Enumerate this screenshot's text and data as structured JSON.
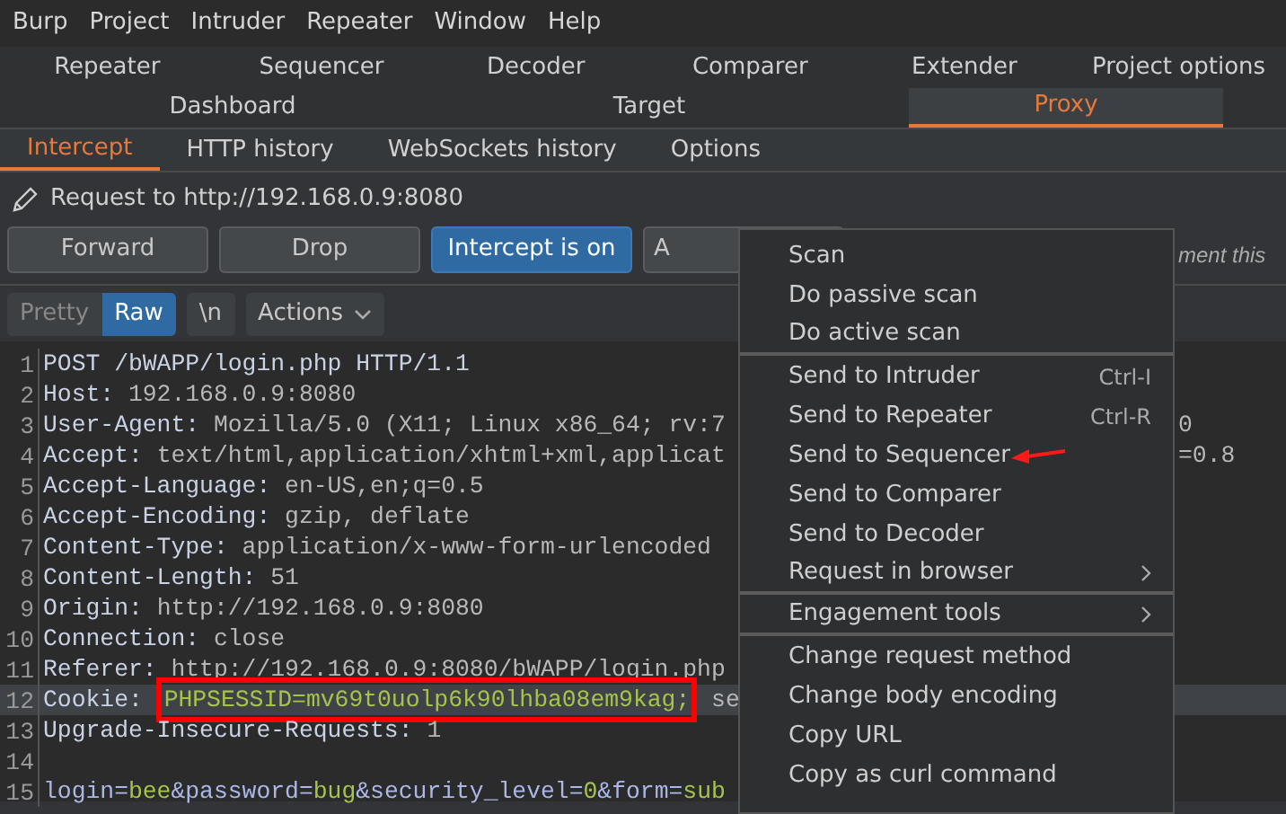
{
  "menu_bar": [
    "Burp",
    "Project",
    "Intruder",
    "Repeater",
    "Window",
    "Help"
  ],
  "tool_tabs_row_1": [
    {
      "label": "Repeater",
      "selected": false
    },
    {
      "label": "Sequencer",
      "selected": false
    },
    {
      "label": "Decoder",
      "selected": false
    },
    {
      "label": "Comparer",
      "selected": false
    },
    {
      "label": "Extender",
      "selected": false
    },
    {
      "label": "Project options",
      "selected": false
    }
  ],
  "tool_tabs_row_2": [
    {
      "label": "Dashboard",
      "selected": false
    },
    {
      "label": "Target",
      "selected": false
    },
    {
      "label": "Proxy",
      "selected": true
    }
  ],
  "proxy_tabs": [
    {
      "label": "Intercept",
      "selected": true
    },
    {
      "label": "HTTP history",
      "selected": false
    },
    {
      "label": "WebSockets history",
      "selected": false
    },
    {
      "label": "Options",
      "selected": false
    }
  ],
  "request_title": "Request to http://192.168.0.9:8080",
  "buttons": [
    {
      "label": "Forward",
      "kind": "plain"
    },
    {
      "label": "Drop",
      "kind": "plain"
    },
    {
      "label": "Intercept is on",
      "kind": "toggle"
    },
    {
      "label": "A",
      "kind": "plain"
    }
  ],
  "comment_field": {
    "value": "ment this"
  },
  "editor_toolbar": {
    "views": [
      {
        "label": "Pretty",
        "selected": false
      },
      {
        "label": "Raw",
        "selected": true
      }
    ],
    "newline_button": "\\n",
    "actions_button": "Actions"
  },
  "request_lines": [
    {
      "number": "1",
      "selected": false,
      "segments": [
        {
          "kind": "name",
          "text": "POST /bWAPP/login.php HTTP/1.1"
        }
      ]
    },
    {
      "number": "2",
      "selected": false,
      "segments": [
        {
          "kind": "name",
          "text": "Host: "
        },
        {
          "kind": "value",
          "text": "192.168.0.9:8080"
        }
      ]
    },
    {
      "number": "3",
      "selected": false,
      "segments": [
        {
          "kind": "name",
          "text": "User-Agent: "
        },
        {
          "kind": "value",
          "text": "Mozilla/5.0 (X11; Linux x86_64; rv:7"
        }
      ],
      "right_text": "0"
    },
    {
      "number": "4",
      "selected": false,
      "segments": [
        {
          "kind": "name",
          "text": "Accept: "
        },
        {
          "kind": "value",
          "text": "text/html,application/xhtml+xml,applicat"
        }
      ],
      "right_text": "=0.8"
    },
    {
      "number": "5",
      "selected": false,
      "segments": [
        {
          "kind": "name",
          "text": "Accept-Language: "
        },
        {
          "kind": "value",
          "text": "en-US,en;q=0.5"
        }
      ]
    },
    {
      "number": "6",
      "selected": false,
      "segments": [
        {
          "kind": "name",
          "text": "Accept-Encoding: "
        },
        {
          "kind": "value",
          "text": "gzip, deflate"
        }
      ]
    },
    {
      "number": "7",
      "selected": false,
      "segments": [
        {
          "kind": "name",
          "text": "Content-Type: "
        },
        {
          "kind": "value",
          "text": "application/x-www-form-urlencoded"
        }
      ]
    },
    {
      "number": "8",
      "selected": false,
      "segments": [
        {
          "kind": "name",
          "text": "Content-Length: "
        },
        {
          "kind": "value",
          "text": "51"
        }
      ]
    },
    {
      "number": "9",
      "selected": false,
      "segments": [
        {
          "kind": "name",
          "text": "Origin: "
        },
        {
          "kind": "value",
          "text": "http://192.168.0.9:8080"
        }
      ]
    },
    {
      "number": "10",
      "selected": false,
      "segments": [
        {
          "kind": "name",
          "text": "Connection: "
        },
        {
          "kind": "value",
          "text": "close"
        }
      ]
    },
    {
      "number": "11",
      "selected": false,
      "segments": [
        {
          "kind": "name",
          "text": "Referer: "
        },
        {
          "kind": "value",
          "text": "http://192.168.0.9:8080/bWAPP/login.php"
        }
      ]
    },
    {
      "number": "12",
      "selected": true,
      "segments": [
        {
          "kind": "name",
          "text": "Cookie: "
        },
        {
          "kind": "boxed",
          "text": "PHPSESSID=mv69t0uolp6k90lhba08em9kag;"
        },
        {
          "kind": "value",
          "text": " se"
        }
      ]
    },
    {
      "number": "13",
      "selected": false,
      "segments": [
        {
          "kind": "name",
          "text": "Upgrade-Insecure-Requests: "
        },
        {
          "kind": "value",
          "text": "1"
        }
      ]
    },
    {
      "number": "14",
      "selected": false
    },
    {
      "number": "15",
      "selected": false,
      "segments": [
        {
          "kind": "param",
          "text": "login="
        },
        {
          "kind": "param_value",
          "text": "bee"
        },
        {
          "kind": "param",
          "text": "&password="
        },
        {
          "kind": "param_value",
          "text": "bug"
        },
        {
          "kind": "param",
          "text": "&security_level="
        },
        {
          "kind": "param_value",
          "text": "0"
        },
        {
          "kind": "param",
          "text": "&form="
        },
        {
          "kind": "param_value",
          "text": "sub"
        }
      ]
    }
  ],
  "context_menu": [
    {
      "label": "Scan",
      "separator_after": false
    },
    {
      "label": "Do passive scan",
      "separator_after": false
    },
    {
      "label": "Do active scan",
      "separator_after": true
    },
    {
      "label": "Send to Intruder",
      "shortcut": "Ctrl-I",
      "separator_after": false
    },
    {
      "label": "Send to Repeater",
      "shortcut": "Ctrl-R",
      "separator_after": false
    },
    {
      "label": "Send to Sequencer",
      "annotated": true,
      "separator_after": false
    },
    {
      "label": "Send to Comparer",
      "separator_after": false
    },
    {
      "label": "Send to Decoder",
      "separator_after": false
    },
    {
      "label": "Request in browser",
      "submenu": true,
      "separator_after": true
    },
    {
      "label": "Engagement tools",
      "submenu": true,
      "separator_after": true
    },
    {
      "label": "Change request method",
      "separator_after": false
    },
    {
      "label": "Change body encoding",
      "separator_after": false
    },
    {
      "label": "Copy URL",
      "separator_after": false
    },
    {
      "label": "Copy as curl command",
      "separator_after": false
    }
  ]
}
